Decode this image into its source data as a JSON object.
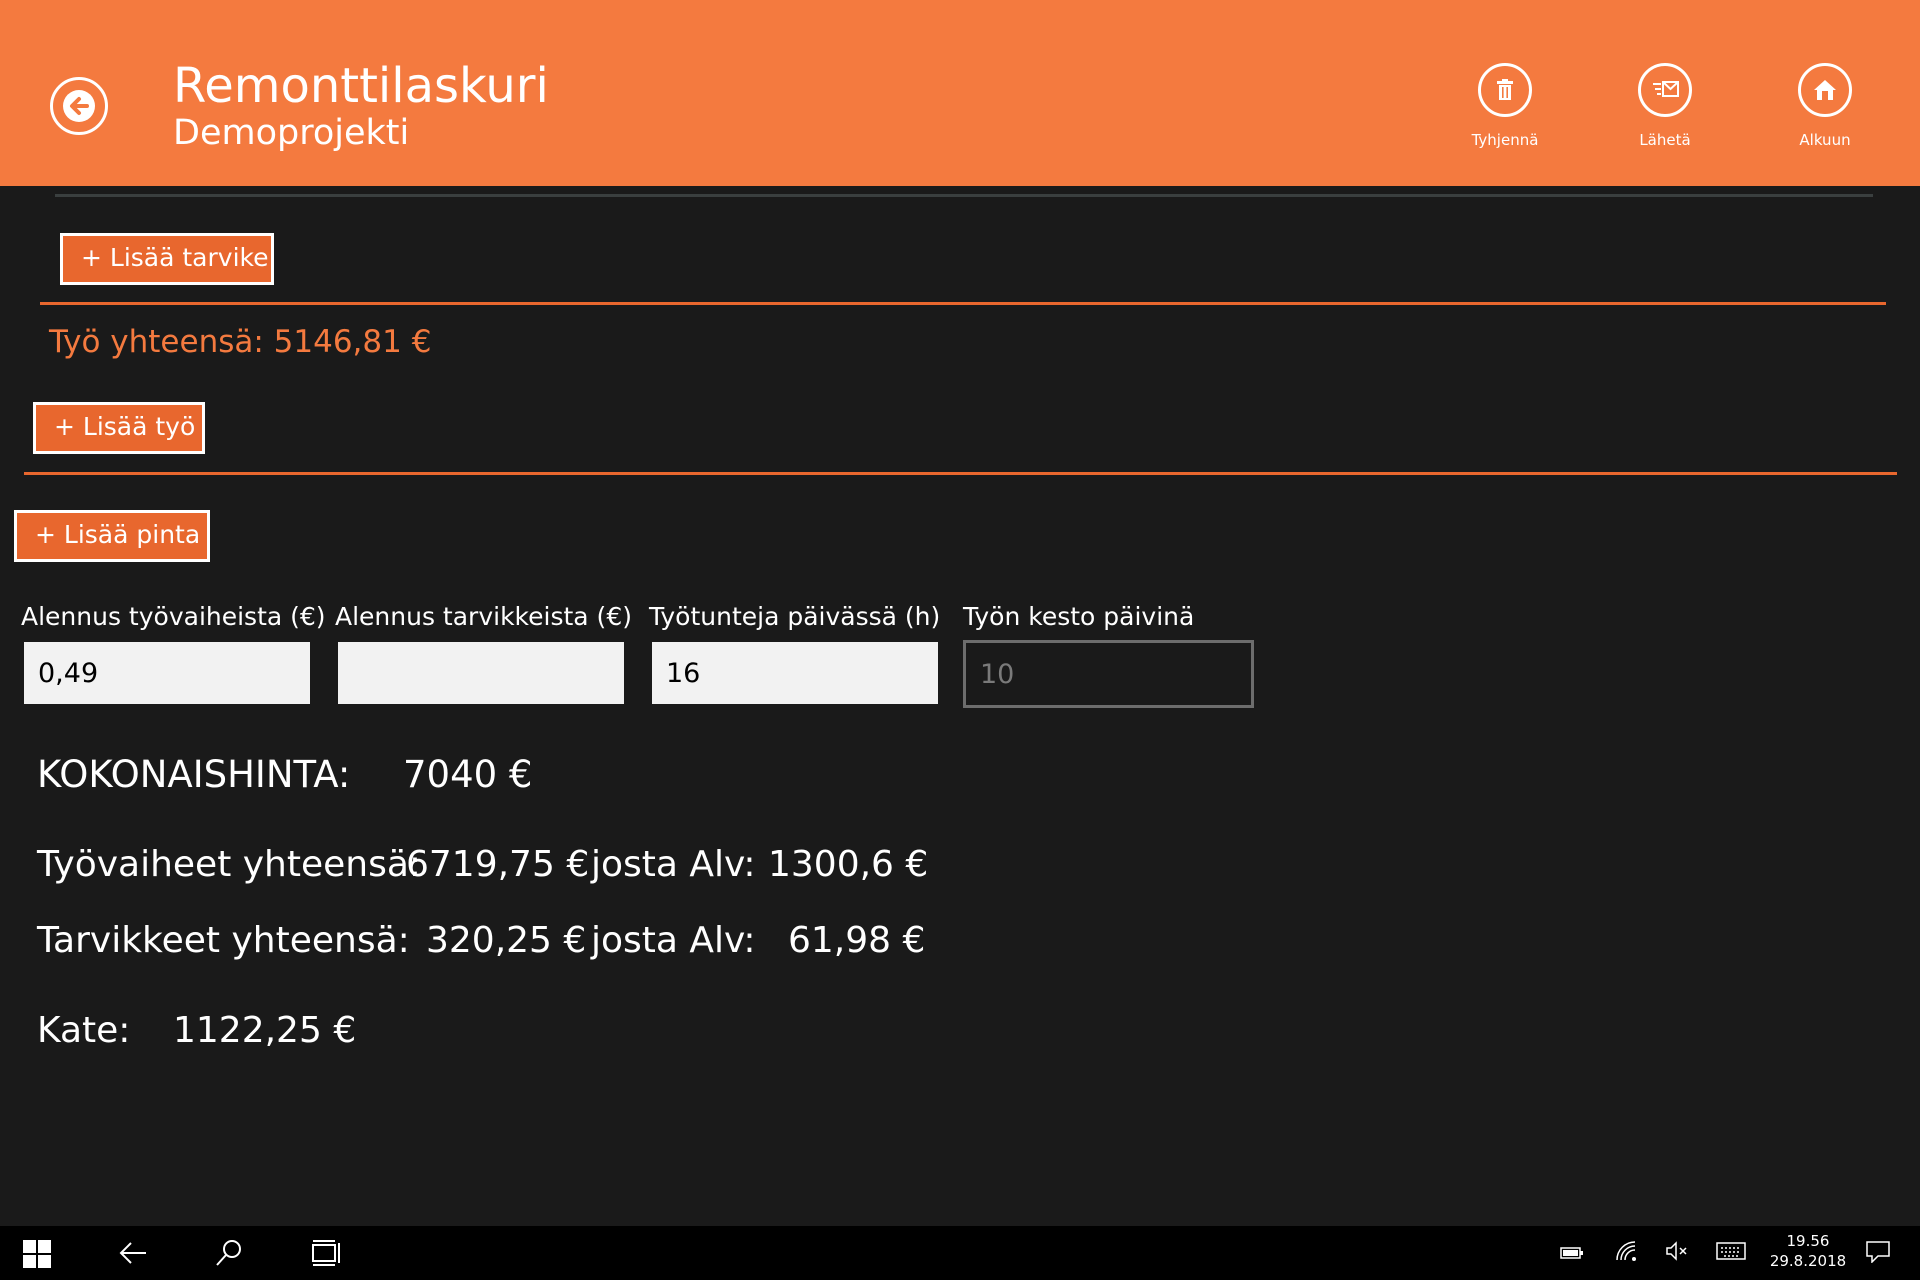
{
  "header": {
    "title": "Remonttilaskuri",
    "subtitle": "Demoprojekti",
    "actions": [
      {
        "label": "Tyhjennä",
        "icon": "trash-icon"
      },
      {
        "label": "Lähetä",
        "icon": "send-mail-icon"
      },
      {
        "label": "Alkuun",
        "icon": "home-icon"
      }
    ],
    "color": "#f47a3f"
  },
  "materials": {
    "add_label": "+ Lisää tarvike"
  },
  "work": {
    "total_label": "Työ yhteensä: 5146,81 €",
    "add_label": "+ Lisää työ"
  },
  "surfaces": {
    "add_label": "+ Lisää pinta"
  },
  "fields": [
    {
      "label": "Alennus työvaiheista (€)",
      "value": "0,49"
    },
    {
      "label": "Alennus tarvikkeista (€)",
      "value": ""
    },
    {
      "label": "Työtunteja päivässä (h)",
      "value": "16"
    },
    {
      "label": "Työn kesto päivinä",
      "value": "10",
      "disabled": true
    }
  ],
  "summary": {
    "total_label": "KOKONAISHINTA:",
    "total_value": "7040 €",
    "work_label": "Työvaiheet yhteensä:",
    "work_value": "6719,75 €",
    "work_vat_label": "josta Alv:",
    "work_vat_value": "1300,6 €",
    "materials_label": "Tarvikkeet yhteensä:",
    "materials_value": "320,25 €",
    "materials_vat_label": "josta Alv:",
    "materials_vat_value": "61,98 €",
    "margin_label": "Kate:",
    "margin_value": "1122,25 €"
  },
  "taskbar": {
    "time": "19.56",
    "date": "29.8.2018"
  },
  "accent": "#e8672e"
}
